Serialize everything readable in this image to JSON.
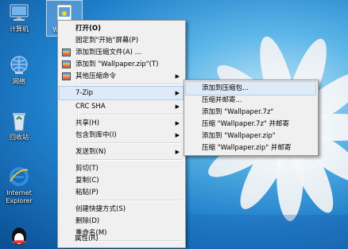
{
  "desktop": {
    "icons": [
      {
        "label": "计算机",
        "icon": "computer-icon"
      },
      {
        "label": "Wallp...",
        "icon": "image-file-icon"
      },
      {
        "label": "网络",
        "icon": "network-icon"
      },
      {
        "label": "回收站",
        "icon": "recycle-bin-icon"
      },
      {
        "label": "Internet Explorer",
        "icon": "internet-explorer-icon"
      },
      {
        "label": "QQ",
        "icon": "qq-penguin-icon"
      }
    ]
  },
  "context_menu": {
    "items": [
      {
        "label": "打开(O)",
        "bold": true
      },
      {
        "label": "固定到\"开始\"屏幕(P)"
      },
      {
        "label": "添加到压缩文件(A) ...",
        "icon": "winrar-archive-icon"
      },
      {
        "label": "添加到 \"Wallpaper.zip\"(T)",
        "icon": "winrar-archive-icon"
      },
      {
        "label": "其他压缩命令",
        "icon": "winrar-archive-icon",
        "submenu": true
      },
      {
        "label": "7-Zip",
        "submenu": true,
        "highlighted": true
      },
      {
        "label": "CRC SHA",
        "submenu": true
      },
      {
        "label": "共享(H)",
        "submenu": true
      },
      {
        "label": "包含到库中(I)",
        "submenu": true
      },
      {
        "label": "发送到(N)",
        "submenu": true
      },
      {
        "label": "剪切(T)"
      },
      {
        "label": "复制(C)"
      },
      {
        "label": "粘贴(P)"
      },
      {
        "label": "创建快捷方式(S)"
      },
      {
        "label": "删除(D)"
      },
      {
        "label": "重命名(M)"
      },
      {
        "label": "属性(R)"
      }
    ]
  },
  "submenu_7zip": {
    "items": [
      {
        "label": "添加到压缩包...",
        "highlighted": true
      },
      {
        "label": "压缩并邮寄..."
      },
      {
        "label": "添加到 \"Wallpaper.7z\""
      },
      {
        "label": "压缩 \"Wallpaper.7z\" 并邮寄"
      },
      {
        "label": "添加到 \"Wallpaper.zip\""
      },
      {
        "label": "压缩 \"Wallpaper.zip\" 并邮寄"
      }
    ]
  },
  "colors": {
    "menu_bg": "#f0f0f0",
    "highlight": "#dfeaf7",
    "highlight_border": "#aecff0"
  }
}
